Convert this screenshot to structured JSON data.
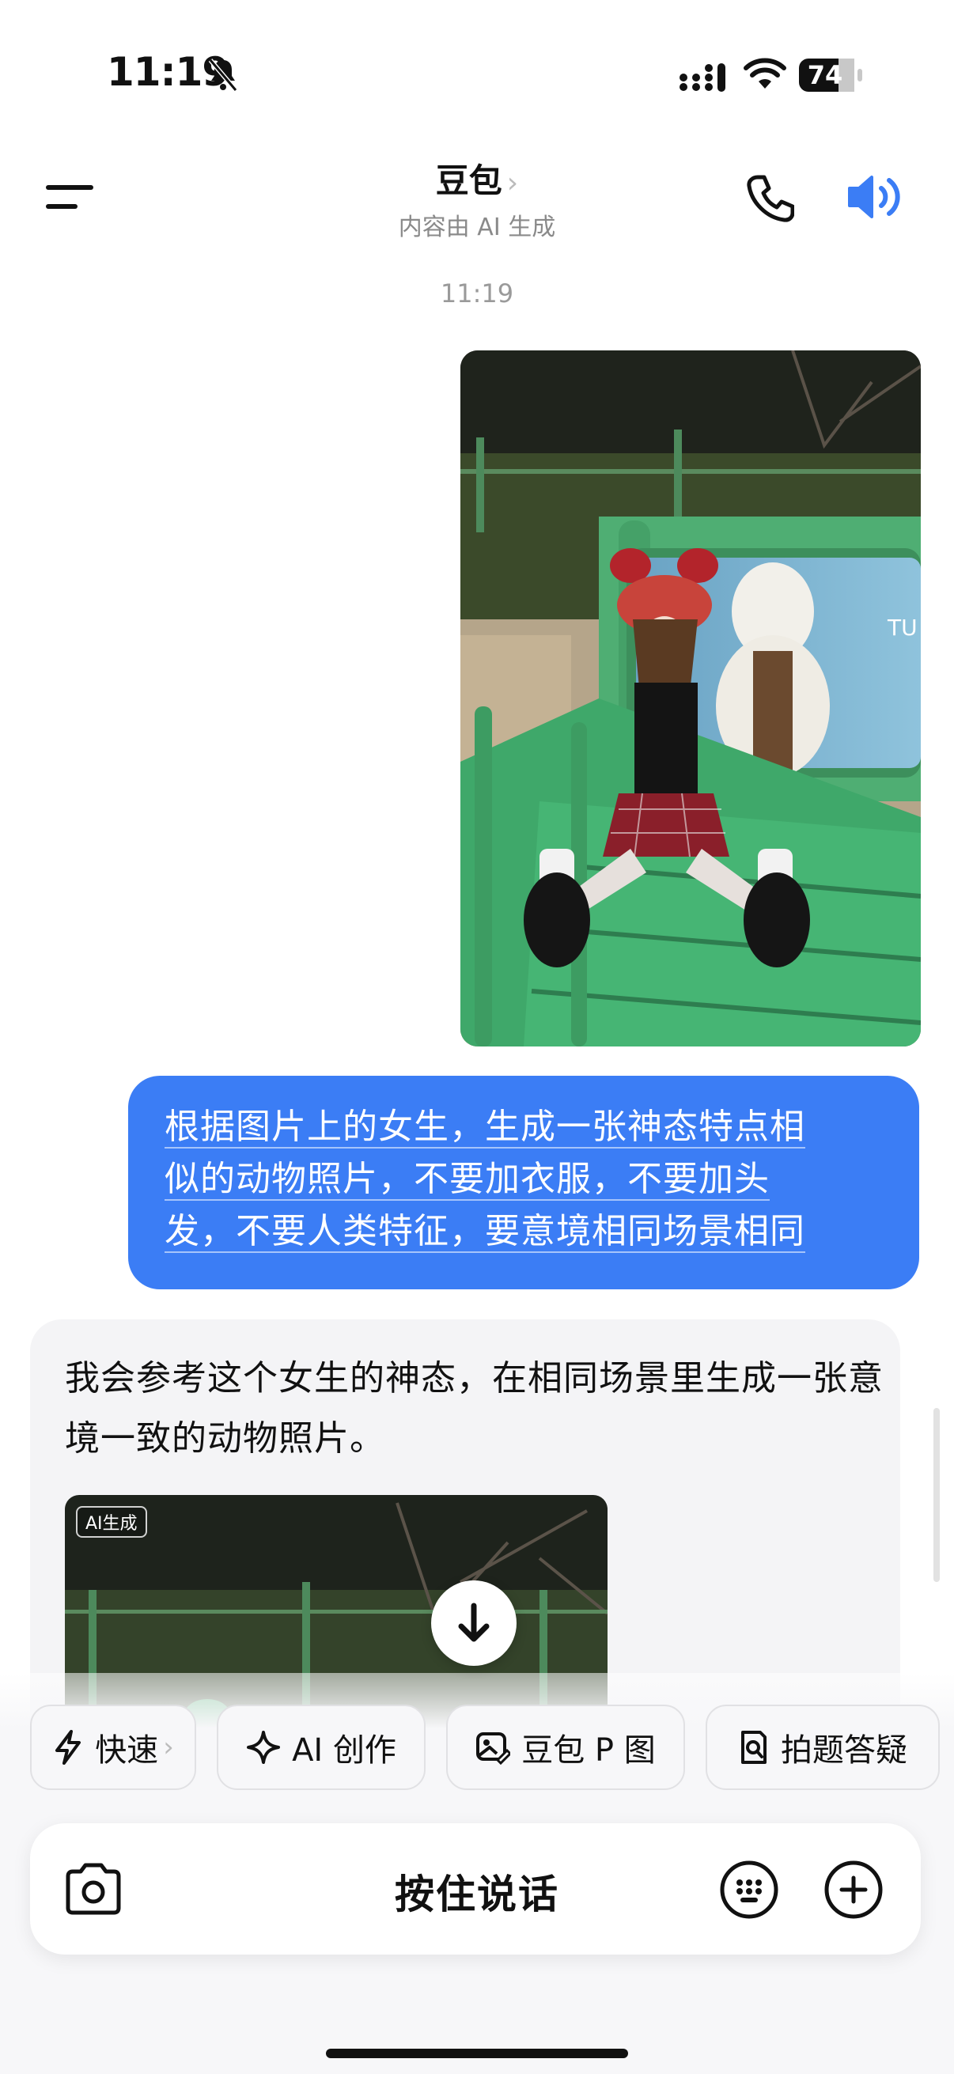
{
  "status_bar": {
    "time": "11:19",
    "battery": "74"
  },
  "header": {
    "title": "豆包",
    "title_chevron": "›",
    "subtitle": "内容由 AI 生成"
  },
  "chat": {
    "timestamp": "11:19",
    "user_message_lines": [
      "根据图片上的女生，生成一张神态特点相",
      "似的动物照片，不要加衣服，不要加头",
      "发，不要人类特征，要意境相同场景相同"
    ],
    "assistant_message": "我会参考这个女生的神态，在相同场景里生成一张意境一致的动物照片。",
    "ai_badge": "AI生成"
  },
  "photo_sign_text": "TU",
  "quick_actions": [
    {
      "label": "快速",
      "icon": "lightning-icon"
    },
    {
      "label": "AI 创作",
      "icon": "sparkle-icon"
    },
    {
      "label": "豆包 P 图",
      "icon": "image-edit-icon"
    },
    {
      "label": "拍题答疑",
      "icon": "doc-search-icon"
    }
  ],
  "input": {
    "hold_to_talk": "按住说话"
  },
  "colors": {
    "accent": "#3b7df5",
    "bench_green": "#4fae73",
    "bubble_gray": "#f4f4f6"
  }
}
